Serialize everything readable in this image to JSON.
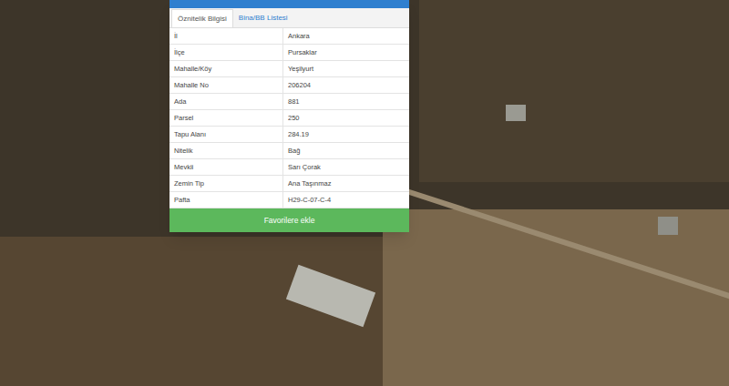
{
  "tabs": [
    {
      "label": "Öznitelik Bilgisi",
      "selected": true
    },
    {
      "label": "Bina/BB Listesi",
      "selected": false
    }
  ],
  "attributes": [
    {
      "label": "İl",
      "value": "Ankara"
    },
    {
      "label": "İlçe",
      "value": "Pursaklar"
    },
    {
      "label": "Mahalle/Köy",
      "value": "Yeşilyurt"
    },
    {
      "label": "Mahalle No",
      "value": "206204"
    },
    {
      "label": "Ada",
      "value": "881"
    },
    {
      "label": "Parsel",
      "value": "250"
    },
    {
      "label": "Tapu Alanı",
      "value": "284.19"
    },
    {
      "label": "Nitelik",
      "value": "Bağ"
    },
    {
      "label": "Mevkii",
      "value": "Sarı Çorak"
    },
    {
      "label": "Zemin Tip",
      "value": "Ana Taşınmaz"
    },
    {
      "label": "Pafta",
      "value": "H29-C-07-C-4"
    }
  ],
  "button": "Favorilere ekle"
}
